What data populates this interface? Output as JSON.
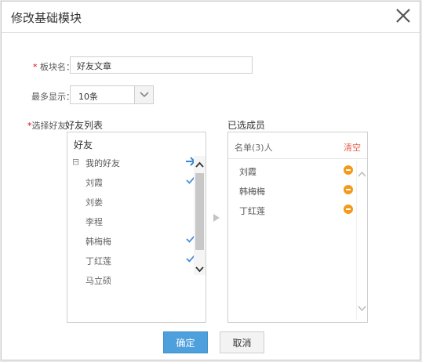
{
  "dialog": {
    "title": "修改基础模块",
    "close_icon": "close-icon"
  },
  "form": {
    "name_required": "*",
    "name_label": "板块名：",
    "name_value": "好友文章",
    "max_label": "最多显示：",
    "max_value": "10条",
    "friends_required": "*",
    "friends_label": "选择好友"
  },
  "friend_list": {
    "title": "好友列表",
    "root": "好友",
    "group_toggle": "⊟",
    "group_name": "我的好友",
    "items": [
      {
        "name": "刘霞",
        "checked": true
      },
      {
        "name": "刘娄",
        "checked": false
      },
      {
        "name": "李程",
        "checked": false
      },
      {
        "name": "韩梅梅",
        "checked": true
      },
      {
        "name": "丁红莲",
        "checked": true
      },
      {
        "name": "马立硕",
        "checked": false
      }
    ]
  },
  "selected": {
    "title": "已选成员",
    "count_label": "名单(3)人",
    "clear_label": "清空",
    "items": [
      "刘霞",
      "韩梅梅",
      "丁红莲"
    ]
  },
  "buttons": {
    "ok": "确定",
    "cancel": "取消"
  },
  "colors": {
    "accent": "#4ea0dc",
    "check": "#4a90d9",
    "remove": "#f39a1a",
    "clear": "#e8624b",
    "required": "#e60012"
  }
}
